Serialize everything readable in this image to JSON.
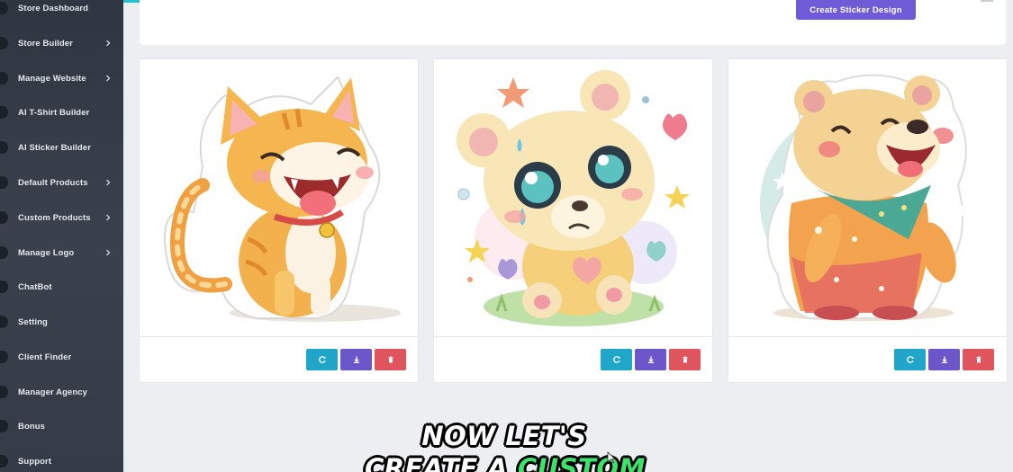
{
  "sidebar": {
    "items": [
      {
        "label": "Store Dashboard",
        "has_chevron": false
      },
      {
        "label": "Store Builder",
        "has_chevron": true
      },
      {
        "label": "Manage Website",
        "has_chevron": true
      },
      {
        "label": "AI T-Shirt Builder",
        "has_chevron": false
      },
      {
        "label": "AI Sticker Builder",
        "has_chevron": false
      },
      {
        "label": "Default Products",
        "has_chevron": true
      },
      {
        "label": "Custom Products",
        "has_chevron": true
      },
      {
        "label": "Manage Logo",
        "has_chevron": true
      },
      {
        "label": "ChatBot",
        "has_chevron": false
      },
      {
        "label": "Setting",
        "has_chevron": false
      },
      {
        "label": "Client Finder",
        "has_chevron": false
      },
      {
        "label": "Manager Agency",
        "has_chevron": false
      },
      {
        "label": "Bonus",
        "has_chevron": false
      },
      {
        "label": "Support",
        "has_chevron": false
      }
    ]
  },
  "toolbar": {
    "create_label": "Create Sticker Design"
  },
  "stickers": [
    {
      "subject": "laughing orange kitten sticker",
      "icon": "cat-sticker-image"
    },
    {
      "subject": "crying teddy bear sticker",
      "icon": "bear-sticker-image"
    },
    {
      "subject": "laughing bear with scarf sticker",
      "icon": "bear-laughing-sticker-image"
    }
  ],
  "actions": {
    "icons": [
      "refresh-icon",
      "download-icon",
      "trash-icon"
    ]
  },
  "caption": {
    "line1": "NOW LET'S",
    "line2_prefix": "CREATE A ",
    "line2_highlight": "CUSTOM"
  },
  "colors": {
    "sidebar_bg": "#353b47",
    "accent_purple": "#6f5bd6",
    "refresh": "#1fa6c8",
    "download": "#6b57c9",
    "delete": "#e0545e",
    "caption_green": "#3ee26a"
  }
}
